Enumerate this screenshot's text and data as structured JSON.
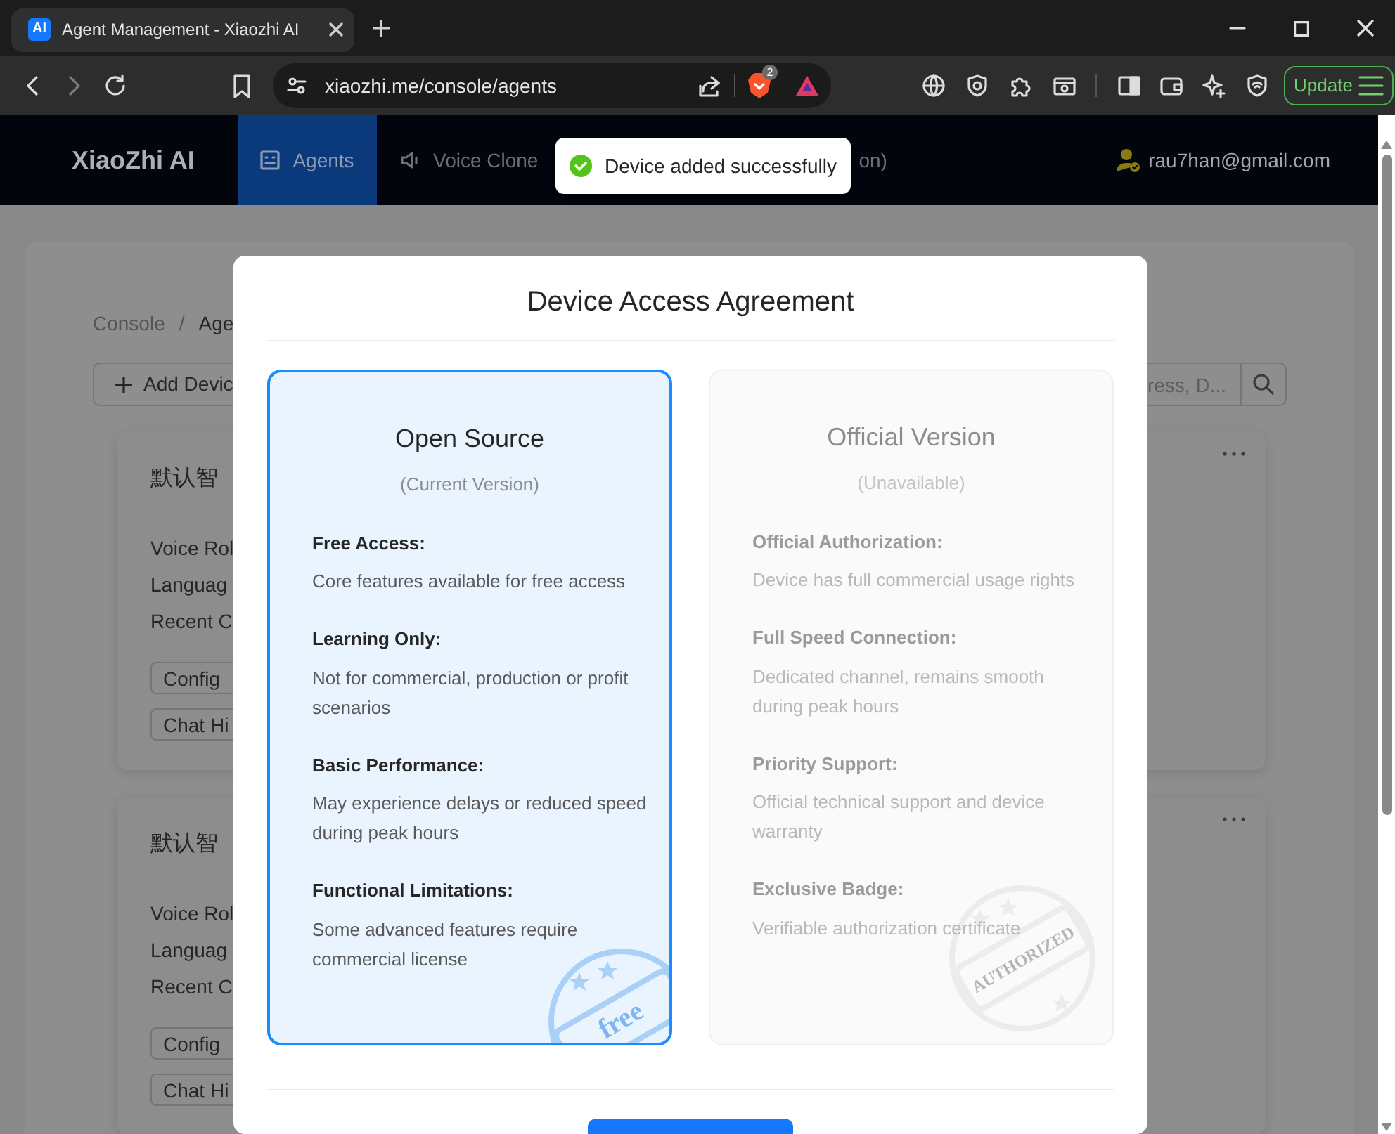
{
  "browser": {
    "tab": {
      "favicon": "AI",
      "title": "Agent Management - Xiaozhi AI"
    },
    "address": "xiaozhi.me/console/agents",
    "shield_count": "2",
    "update_button": "Update"
  },
  "nav": {
    "logo": "XiaoZhi AI",
    "items": [
      {
        "label": "Agents",
        "selected": true
      },
      {
        "label": "Voice Clone",
        "selected": false
      },
      {
        "label": "on)",
        "selected": false
      }
    ],
    "user": "rau7han@gmail.com"
  },
  "toast": {
    "message": "Device added successfully"
  },
  "page": {
    "breadcrumb": {
      "items": [
        "Console",
        "Age"
      ],
      "separator": "/"
    },
    "add_button": "Add Devic",
    "search": {
      "placeholder": "ress, D..."
    },
    "agent_cards": [
      {
        "title": "默认智",
        "fields": [
          "Voice Rol",
          "Languag",
          "Recent C"
        ],
        "buttons": [
          "Config",
          "Chat Hi"
        ]
      },
      {
        "title": "默认智",
        "fields": [
          "Voice Rol",
          "Languag",
          "Recent C"
        ],
        "buttons": [
          "Config",
          "Chat Hi"
        ]
      }
    ]
  },
  "dialog": {
    "title": "Device Access Agreement",
    "options": [
      {
        "title": "Open Source",
        "subtitle": "(Current Version)",
        "selected": true,
        "disabled": false,
        "stamp": "free",
        "features": [
          {
            "heading": "Free Access:",
            "text": "Core features available for free access"
          },
          {
            "heading": "Learning Only:",
            "text": "Not for commercial, production or profit scenarios"
          },
          {
            "heading": "Basic Performance:",
            "text": "May experience delays or reduced speed during peak hours"
          },
          {
            "heading": "Functional Limitations:",
            "text": "Some advanced features require commercial license"
          }
        ]
      },
      {
        "title": "Official Version",
        "subtitle": "(Unavailable)",
        "selected": false,
        "disabled": true,
        "stamp": "AUTHORIZED",
        "features": [
          {
            "heading": "Official Authorization:",
            "text": "Device has full commercial usage rights"
          },
          {
            "heading": "Full Speed Connection:",
            "text": "Dedicated channel, remains smooth during peak hours"
          },
          {
            "heading": "Priority Support:",
            "text": "Official technical support and device warranty"
          },
          {
            "heading": "Exclusive Badge:",
            "text": "Verifiable authorization certificate"
          }
        ]
      }
    ]
  }
}
